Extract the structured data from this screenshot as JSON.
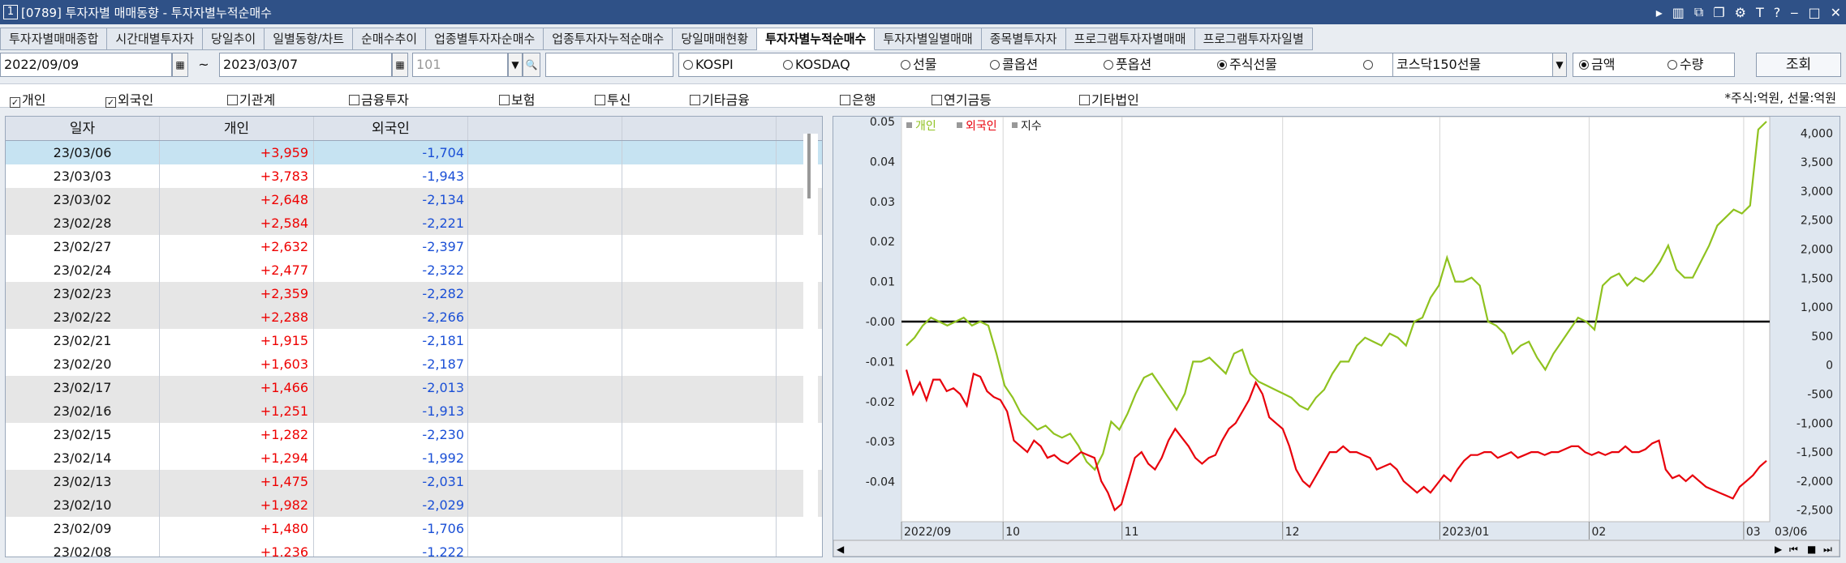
{
  "title": {
    "num": "1",
    "text": "[0789] 투자자별 매매동향 - 투자자별누적순매수"
  },
  "tabs": [
    {
      "label": "투자자별매매종합",
      "active": false
    },
    {
      "label": "시간대별투자자",
      "active": false
    },
    {
      "label": "당일추이",
      "active": false
    },
    {
      "label": "일별동향/차트",
      "active": false
    },
    {
      "label": "순매수추이",
      "active": false
    },
    {
      "label": "업종별투자자순매수",
      "active": false
    },
    {
      "label": "업종투자자누적순매수",
      "active": false
    },
    {
      "label": "당일매매현황",
      "active": false
    },
    {
      "label": "투자자별누적순매수",
      "active": true
    },
    {
      "label": "투자자별일별매매",
      "active": false
    },
    {
      "label": "종목별투자자",
      "active": false
    },
    {
      "label": "프로그램투자자별매매",
      "active": false
    },
    {
      "label": "프로그램투자자일별",
      "active": false
    }
  ],
  "filters": {
    "start_date": "2022/09/09",
    "tilde": "~",
    "end_date": "2023/03/07",
    "code": "101",
    "radios": [
      {
        "label": "KOSPI",
        "checked": false
      },
      {
        "label": "KOSDAQ",
        "checked": false
      },
      {
        "label": "선물",
        "checked": false
      },
      {
        "label": "콜옵션",
        "checked": false
      },
      {
        "label": "풋옵션",
        "checked": false
      },
      {
        "label": "주식선물",
        "checked": true
      },
      {
        "label": "",
        "checked": false
      }
    ],
    "product_select": "코스닥150선물",
    "amount_label": "금액",
    "amount_checked": true,
    "qty_label": "수량",
    "qty_checked": false,
    "search_button": "조회"
  },
  "investors": [
    {
      "label": "개인",
      "checked": true
    },
    {
      "label": "외국인",
      "checked": true
    },
    {
      "label": "기관계",
      "checked": false
    },
    {
      "label": "금융투자",
      "checked": false
    },
    {
      "label": "보험",
      "checked": false
    },
    {
      "label": "투신",
      "checked": false
    },
    {
      "label": "기타금융",
      "checked": false
    },
    {
      "label": "은행",
      "checked": false
    },
    {
      "label": "연기금등",
      "checked": false
    },
    {
      "label": "기타법인",
      "checked": false
    }
  ],
  "unit_note": "*주식:억원, 선물:억원",
  "table": {
    "headers": [
      "일자",
      "개인",
      "외국인",
      "",
      ""
    ],
    "rows": [
      [
        "23/03/06",
        "+3,959",
        "-1,704"
      ],
      [
        "23/03/03",
        "+3,783",
        "-1,943"
      ],
      [
        "23/03/02",
        "+2,648",
        "-2,134"
      ],
      [
        "23/02/28",
        "+2,584",
        "-2,221"
      ],
      [
        "23/02/27",
        "+2,632",
        "-2,397"
      ],
      [
        "23/02/24",
        "+2,477",
        "-2,322"
      ],
      [
        "23/02/23",
        "+2,359",
        "-2,282"
      ],
      [
        "23/02/22",
        "+2,288",
        "-2,266"
      ],
      [
        "23/02/21",
        "+1,915",
        "-2,181"
      ],
      [
        "23/02/20",
        "+1,603",
        "-2,187"
      ],
      [
        "23/02/17",
        "+1,466",
        "-2,013"
      ],
      [
        "23/02/16",
        "+1,251",
        "-1,913"
      ],
      [
        "23/02/15",
        "+1,282",
        "-2,230"
      ],
      [
        "23/02/14",
        "+1,294",
        "-1,992"
      ],
      [
        "23/02/13",
        "+1,475",
        "-2,031"
      ],
      [
        "23/02/10",
        "+1,982",
        "-2,029"
      ],
      [
        "23/02/09",
        "+1,480",
        "-1,706"
      ],
      [
        "23/02/08",
        "+1,236",
        "-1,222"
      ]
    ]
  },
  "chart_data": {
    "type": "line",
    "legend": [
      {
        "name": "개인",
        "color": "#8fc21f"
      },
      {
        "name": "외국인",
        "color": "#e8000b"
      },
      {
        "name": "지수",
        "color": "#000000"
      }
    ],
    "x_labels": [
      "2022/09",
      "10",
      "11",
      "12",
      "2023/01",
      "02",
      "03"
    ],
    "x_end_label": "03/06",
    "left_ticks": [
      "0.05",
      "0.04",
      "0.03",
      "0.02",
      "0.01",
      "-0.00",
      "-0.01",
      "-0.02",
      "-0.03",
      "-0.04"
    ],
    "right_ticks": [
      "4,000",
      "3,500",
      "3,000",
      "2,500",
      "2,000",
      "1,500",
      "1,000",
      "500",
      "0",
      "-500",
      "-1,000",
      "-1,500",
      "-2,000",
      "-2,500"
    ],
    "ylim_left": [
      -0.05,
      0.05
    ],
    "ylim_right": [
      -2700,
      4200
    ],
    "index_value": -0.0,
    "series": [
      {
        "name": "개인",
        "axis": "left",
        "color": "#8fc21f",
        "values": [
          -0.006,
          -0.004,
          -0.001,
          0.001,
          0.0,
          -0.001,
          0.0,
          0.001,
          -0.001,
          0.0,
          -0.001,
          -0.008,
          -0.016,
          -0.019,
          -0.023,
          -0.025,
          -0.027,
          -0.026,
          -0.028,
          -0.029,
          -0.028,
          -0.031,
          -0.035,
          -0.037,
          -0.033,
          -0.025,
          -0.027,
          -0.023,
          -0.018,
          -0.014,
          -0.013,
          -0.016,
          -0.019,
          -0.022,
          -0.018,
          -0.01,
          -0.01,
          -0.009,
          -0.011,
          -0.013,
          -0.008,
          -0.007,
          -0.013,
          -0.015,
          -0.016,
          -0.017,
          -0.018,
          -0.019,
          -0.021,
          -0.022,
          -0.019,
          -0.017,
          -0.013,
          -0.01,
          -0.01,
          -0.006,
          -0.004,
          -0.005,
          -0.006,
          -0.003,
          -0.004,
          -0.006,
          0.0,
          0.001,
          0.006,
          0.009,
          0.016,
          0.01,
          0.01,
          0.011,
          0.009,
          0.0,
          -0.001,
          -0.003,
          -0.008,
          -0.006,
          -0.005,
          -0.009,
          -0.012,
          -0.008,
          -0.005,
          -0.002,
          0.001,
          0.0,
          -0.002,
          0.009,
          0.011,
          0.012,
          0.009,
          0.011,
          0.01,
          0.012,
          0.015,
          0.019,
          0.013,
          0.011,
          0.011,
          0.015,
          0.019,
          0.024,
          0.026,
          0.028,
          0.027,
          0.029,
          0.048,
          0.05
        ]
      },
      {
        "name": "외국인",
        "axis": "right",
        "color": "#e8000b",
        "values": [
          -80,
          -500,
          -300,
          -600,
          -250,
          -250,
          -450,
          -400,
          -500,
          -700,
          -150,
          -200,
          -450,
          -550,
          -600,
          -800,
          -1300,
          -1400,
          -1500,
          -1300,
          -1400,
          -1600,
          -1550,
          -1650,
          -1700,
          -1600,
          -1500,
          -1550,
          -1600,
          -2000,
          -2200,
          -2500,
          -2400,
          -2000,
          -1600,
          -1500,
          -1700,
          -1800,
          -1600,
          -1300,
          -1100,
          -1250,
          -1400,
          -1600,
          -1700,
          -1600,
          -1550,
          -1300,
          -1100,
          -1000,
          -800,
          -600,
          -300,
          -500,
          -900,
          -1000,
          -1100,
          -1400,
          -1800,
          -2000,
          -2100,
          -1900,
          -1700,
          -1500,
          -1500,
          -1400,
          -1500,
          -1500,
          -1550,
          -1600,
          -1800,
          -1750,
          -1700,
          -1800,
          -2000,
          -2100,
          -2200,
          -2100,
          -2200,
          -2050,
          -1900,
          -2000,
          -1800,
          -1650,
          -1550,
          -1550,
          -1500,
          -1500,
          -1600,
          -1550,
          -1500,
          -1600,
          -1550,
          -1500,
          -1500,
          -1550,
          -1500,
          -1500,
          -1450,
          -1400,
          -1400,
          -1500,
          -1550,
          -1500,
          -1550,
          -1500,
          -1500,
          -1400,
          -1500,
          -1500,
          -1450,
          -1350,
          -1300,
          -1800,
          -1950,
          -1900,
          -2000,
          -1900,
          -2000,
          -2100,
          -2150,
          -2200,
          -2250,
          -2300,
          -2100,
          -2000,
          -1900,
          -1750,
          -1650
        ]
      },
      {
        "name": "지수",
        "axis": "left",
        "color": "#000000",
        "values": [
          0.0,
          0.0
        ]
      }
    ]
  }
}
